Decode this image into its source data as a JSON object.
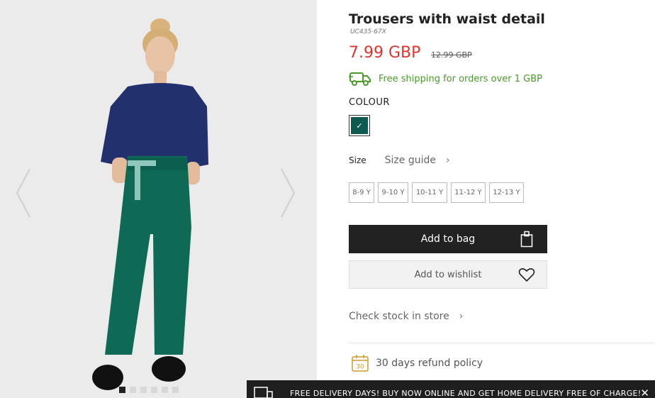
{
  "product": {
    "title": "Trousers with waist detail",
    "sku": "UC435-67X",
    "price_current": "7.99 GBP",
    "price_old": "12.99 GBP",
    "shipping_text": "Free shipping for orders over 1 GBP"
  },
  "colour": {
    "label": "COLOUR",
    "selected_hex": "#0d5a50",
    "check": "✓"
  },
  "size": {
    "label": "Size",
    "guide_label": "Size guide",
    "options": [
      "8-9 Y",
      "9-10 Y",
      "10-11 Y",
      "11-12 Y",
      "12-13 Y"
    ]
  },
  "actions": {
    "add_to_bag": "Add to bag",
    "add_to_wishlist": "Add to wishlist",
    "check_stock": "Check stock in store"
  },
  "refund": {
    "icon_number": "30",
    "text": "30 days refund policy"
  },
  "banner": {
    "text": "FREE DELIVERY DAYS! BUY NOW ONLINE AND GET HOME DELIVERY FREE OF CHARGE!",
    "close": "✕"
  },
  "gallery": {
    "image_count": 6,
    "active_index": 0
  },
  "colors": {
    "price_red": "#e2342d",
    "shipping_green": "#4a9a2a",
    "button_dark": "#222222"
  }
}
